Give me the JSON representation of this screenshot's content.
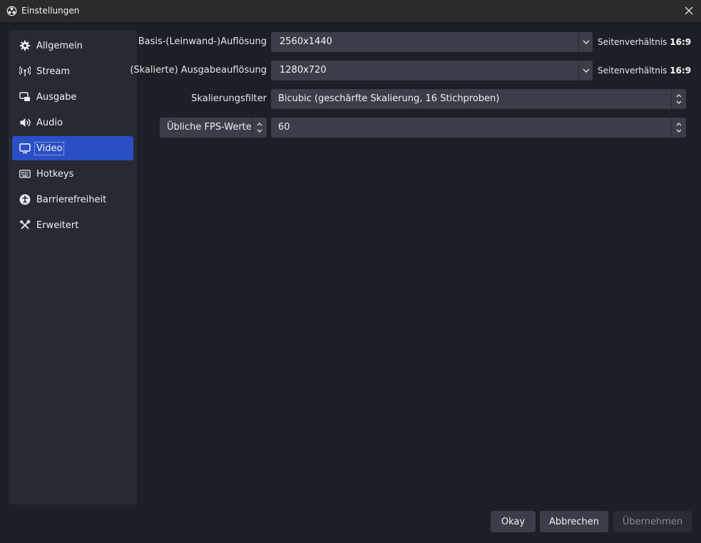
{
  "window": {
    "title": "Einstellungen",
    "app_icon": "obs-logo-icon",
    "close_icon": "close-icon"
  },
  "sidebar": {
    "items": [
      {
        "label": "Allgemein",
        "icon": "gear-icon"
      },
      {
        "label": "Stream",
        "icon": "antenna-icon"
      },
      {
        "label": "Ausgabe",
        "icon": "output-icon"
      },
      {
        "label": "Audio",
        "icon": "speaker-icon"
      },
      {
        "label": "Video",
        "icon": "monitor-icon",
        "active": true
      },
      {
        "label": "Hotkeys",
        "icon": "keyboard-icon"
      },
      {
        "label": "Barrierefreiheit",
        "icon": "accessibility-icon"
      },
      {
        "label": "Erweitert",
        "icon": "tools-icon"
      }
    ]
  },
  "video": {
    "base_resolution": {
      "label": "Basis-(Leinwand-)Auflösung",
      "value": "2560x1440",
      "aspect_prefix": "Seitenverhältnis",
      "aspect_value": "16:9"
    },
    "output_resolution": {
      "label": "(Skalierte) Ausgabeauflösung",
      "value": "1280x720",
      "aspect_prefix": "Seitenverhältnis",
      "aspect_value": "16:9"
    },
    "scale_filter": {
      "label": "Skalierungsfilter",
      "value": "Bicubic (geschärfte Skalierung, 16 Stichproben)"
    },
    "fps": {
      "type_value": "Übliche FPS-Werte",
      "value": "60"
    }
  },
  "buttons": {
    "ok": "Okay",
    "cancel": "Abbrechen",
    "apply": "Übernehmen"
  },
  "colors": {
    "background": "#1d1f26",
    "sidebar": "#272a33",
    "accent": "#2a4fc4",
    "control": "#3b3e48"
  }
}
